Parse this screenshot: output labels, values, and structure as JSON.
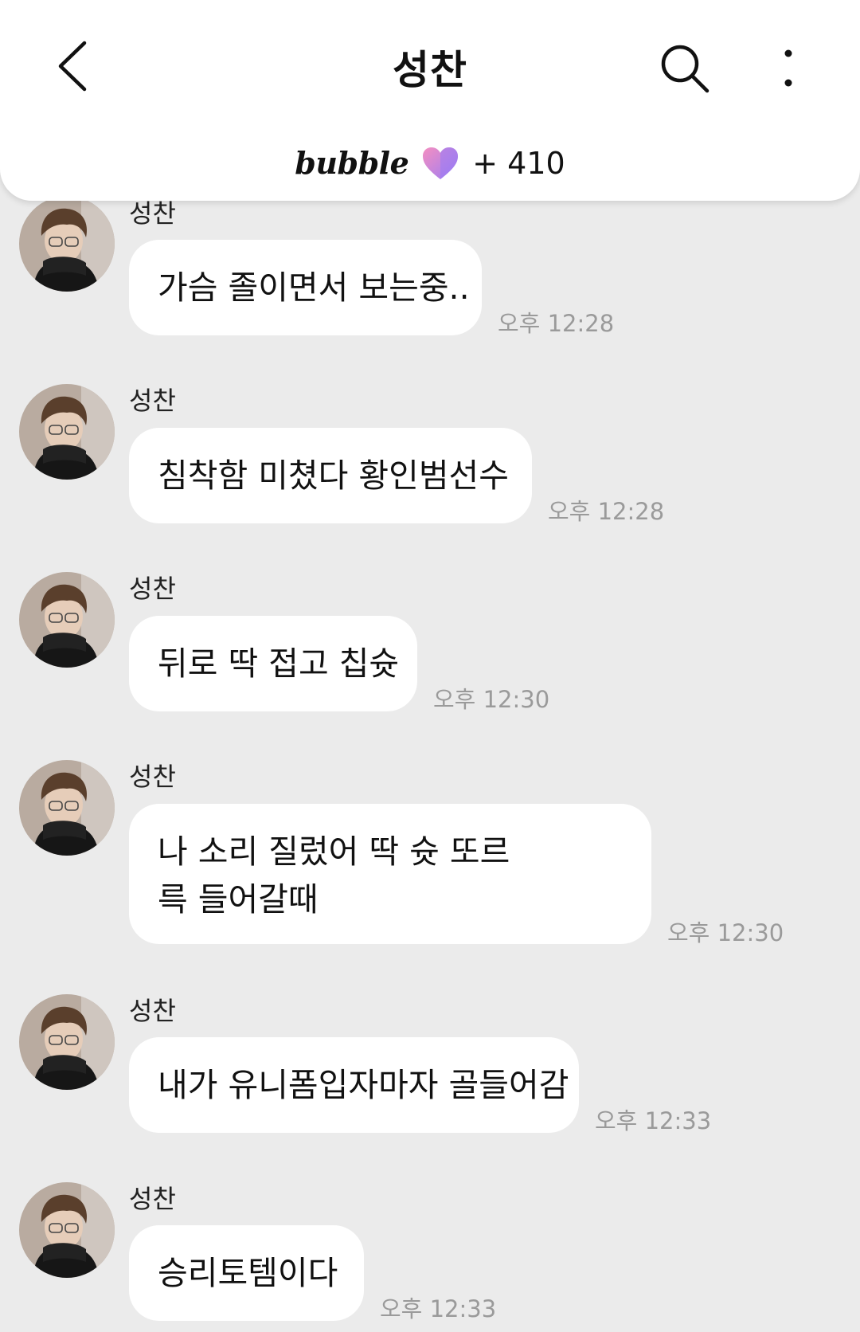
{
  "header": {
    "title": "성찬",
    "brand": "bubble",
    "points": "+ 410",
    "icons": {
      "back": "back-chevron-icon",
      "search": "search-icon",
      "more": "more-vertical-icon",
      "heart": "bubble-heart-icon"
    },
    "colors": {
      "heart_pink": "#f48fc1",
      "heart_purple": "#9b7cf4"
    }
  },
  "messages": [
    {
      "sender": "성찬",
      "text": "가슴 졸이면서 보는중..",
      "time": "오후 12:28"
    },
    {
      "sender": "성찬",
      "text": "침착함 미쳤다 황인범선수",
      "time": "오후 12:28"
    },
    {
      "sender": "성찬",
      "text": "뒤로 딱 접고 칩슛",
      "time": "오후 12:30"
    },
    {
      "sender": "성찬",
      "text": "나 소리 질렀어 딱 슛 또르륵 들어갈때",
      "time": "오후 12:30"
    },
    {
      "sender": "성찬",
      "text": "내가 유니폼입자마자 골들어감",
      "time": "오후 12:33"
    },
    {
      "sender": "성찬",
      "text": "승리토템이다",
      "time": "오후 12:33"
    }
  ]
}
